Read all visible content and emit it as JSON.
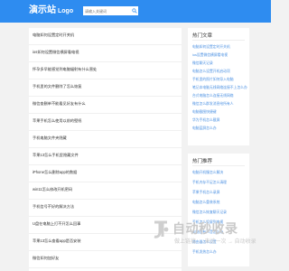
{
  "header": {
    "logo_title": "演示站",
    "logo_sub": "Logo",
    "search_placeholder": "请输入关键词",
    "bg_color": "#2e8cf0"
  },
  "articles": [
    "电脑如何设置定时开关机",
    "ios如何设置微信横屏看电视",
    "怀孕多早能感觉到电脑辐射有什么害处",
    "手机里的文件删除了怎么恢复",
    "微信查删单不能看见好友有什么",
    "苹果手机怎么使用以前的壁纸",
    "手机电脑文件夹隐藏",
    "苹果13怎么手机里隐藏文件",
    "iPhone怎么删除app的数据",
    "win11怎么修改开机密码",
    "手机信号不好的解决方法",
    "U盘在电脑上打不开怎么回事",
    "苹果13怎么查看app是否安装",
    "微信如何加好友"
  ],
  "sidebar": {
    "hot": {
      "title": "热门文章",
      "links": [
        "电脑如何设置定时开关机",
        "ios设置微信横屏看电视",
        "微信聊天记录",
        "电脑怎么设置开机启动项",
        "手机里的照片如何导入电脑",
        "笔记本电脑无线网络连接不上怎么办",
        "台式电脑怎么连接无线网络",
        "微信怎么群发消息给所有人",
        "电脑截图快捷键",
        "华为手机怎么截屏",
        "电脑蓝屏怎么办"
      ]
    },
    "recommend": {
      "title": "热门推荐",
      "links": [
        "电脑开机慢怎么解决",
        "手机内存不足怎么清理",
        "苹果手机怎么录屏",
        "电脑怎么重装系统",
        "微信怎么恢复聊天记录",
        "手机怎么投屏到电视",
        "电脑没有声音怎么办",
        "路由器怎么设置",
        "手机发热怎么办"
      ]
    }
  },
  "watermark": {
    "big": "自动秒收录",
    "small": "做上链接 → 来访一次 → 自动收录"
  }
}
